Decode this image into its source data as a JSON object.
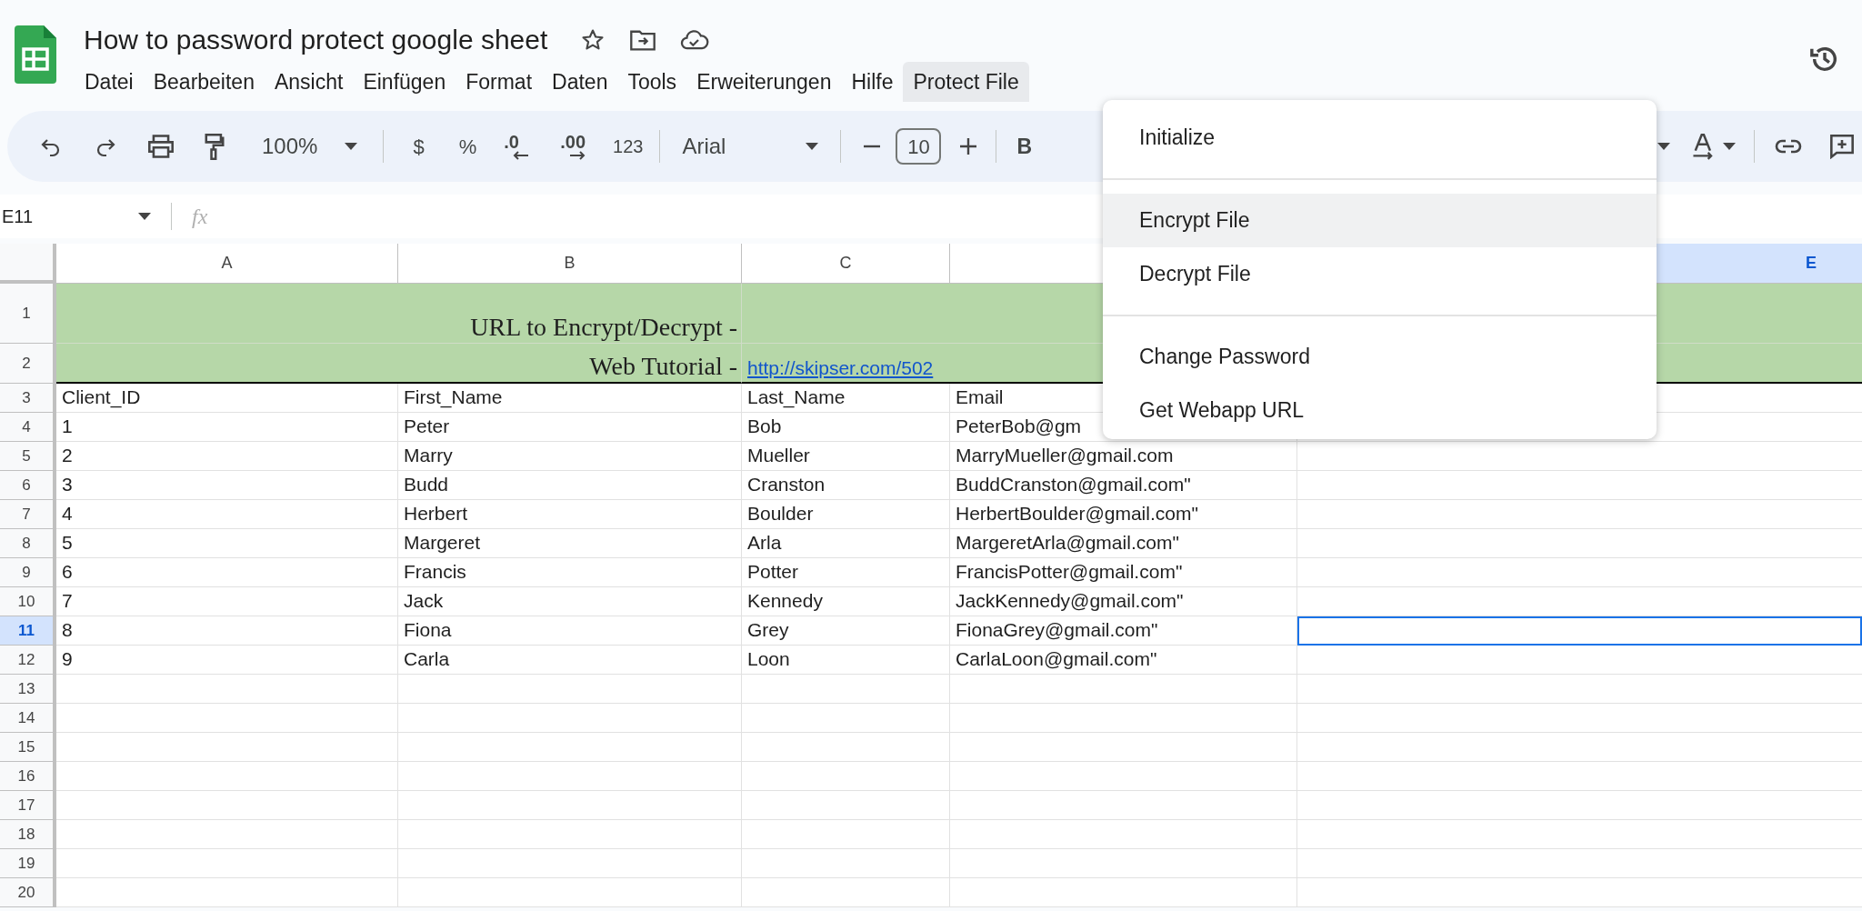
{
  "document": {
    "title": "How to password protect google sheet"
  },
  "menu_bar": [
    {
      "label": "Datei",
      "selected": false
    },
    {
      "label": "Bearbeiten",
      "selected": false
    },
    {
      "label": "Ansicht",
      "selected": false
    },
    {
      "label": "Einfügen",
      "selected": false
    },
    {
      "label": "Format",
      "selected": false
    },
    {
      "label": "Daten",
      "selected": false
    },
    {
      "label": "Tools",
      "selected": false
    },
    {
      "label": "Erweiterungen",
      "selected": false
    },
    {
      "label": "Hilfe",
      "selected": false
    },
    {
      "label": "Protect File",
      "selected": true
    }
  ],
  "toolbar": {
    "zoom": "100%",
    "currency": "$",
    "percent": "%",
    "decimal_decrease": ".0",
    "decimal_increase": ".00",
    "number_format": "123",
    "font": "Arial",
    "font_size": "10",
    "bold": "B"
  },
  "formula_bar": {
    "name_box": "E11",
    "function_label": "fx"
  },
  "columns": [
    {
      "label": "A",
      "selected": false
    },
    {
      "label": "B",
      "selected": false
    },
    {
      "label": "C",
      "selected": false
    },
    {
      "selected": false
    },
    {
      "label": "E",
      "selected": true
    }
  ],
  "rows": [
    {
      "kind": "banner",
      "number": "1",
      "selected": false,
      "label": "URL to Encrypt/Decrypt -"
    },
    {
      "kind": "banner",
      "number": "2",
      "selected": false,
      "label": "Web Tutorial -",
      "link": "http://skipser.com/502"
    },
    {
      "kind": "data",
      "number": "3",
      "selected": false,
      "cells": [
        "Client_ID",
        "First_Name",
        "Last_Name",
        "Email"
      ]
    },
    {
      "kind": "data",
      "number": "4",
      "selected": false,
      "cells": [
        "1",
        "Peter",
        "Bob",
        "PeterBob@gm"
      ]
    },
    {
      "kind": "data",
      "number": "5",
      "selected": false,
      "cells": [
        "2",
        "Marry",
        "Mueller",
        "MarryMueller@gmail.com"
      ]
    },
    {
      "kind": "data",
      "number": "6",
      "selected": false,
      "cells": [
        "3",
        "Budd",
        "Cranston",
        "BuddCranston@gmail.com\""
      ]
    },
    {
      "kind": "data",
      "number": "7",
      "selected": false,
      "cells": [
        "4",
        "Herbert",
        "Boulder",
        "HerbertBoulder@gmail.com\""
      ]
    },
    {
      "kind": "data",
      "number": "8",
      "selected": false,
      "cells": [
        "5",
        "Margeret",
        "Arla",
        "MargeretArla@gmail.com\""
      ]
    },
    {
      "kind": "data",
      "number": "9",
      "selected": false,
      "cells": [
        "6",
        "Francis",
        "Potter",
        "FrancisPotter@gmail.com\""
      ]
    },
    {
      "kind": "data",
      "number": "10",
      "selected": false,
      "cells": [
        "7",
        "Jack",
        "Kennedy",
        "JackKennedy@gmail.com\""
      ]
    },
    {
      "kind": "data",
      "number": "11",
      "selected": true,
      "cells": [
        "8",
        "Fiona",
        "Grey",
        "FionaGrey@gmail.com\""
      ]
    },
    {
      "kind": "data",
      "number": "12",
      "selected": false,
      "cells": [
        "9",
        "Carla",
        "Loon",
        "CarlaLoon@gmail.com\""
      ]
    },
    {
      "kind": "data",
      "number": "13",
      "selected": false
    },
    {
      "kind": "data",
      "number": "14",
      "selected": false
    },
    {
      "kind": "data",
      "number": "15",
      "selected": false
    },
    {
      "kind": "data",
      "number": "16",
      "selected": false
    },
    {
      "kind": "data",
      "number": "17",
      "selected": false
    },
    {
      "kind": "data",
      "number": "18",
      "selected": false
    },
    {
      "kind": "data",
      "number": "19",
      "selected": false
    },
    {
      "kind": "data",
      "number": "20",
      "selected": false
    }
  ],
  "dropdown_menu": {
    "items": [
      {
        "kind": "item",
        "label": "Initialize",
        "selected": false
      },
      {
        "kind": "separator"
      },
      {
        "kind": "item",
        "label": "Encrypt File",
        "selected": true
      },
      {
        "kind": "item",
        "label": "Decrypt File",
        "selected": false
      },
      {
        "kind": "separator"
      },
      {
        "kind": "item",
        "label": "Change Password",
        "selected": false
      },
      {
        "kind": "item",
        "label": "Get Webapp URL",
        "selected": false
      }
    ]
  }
}
